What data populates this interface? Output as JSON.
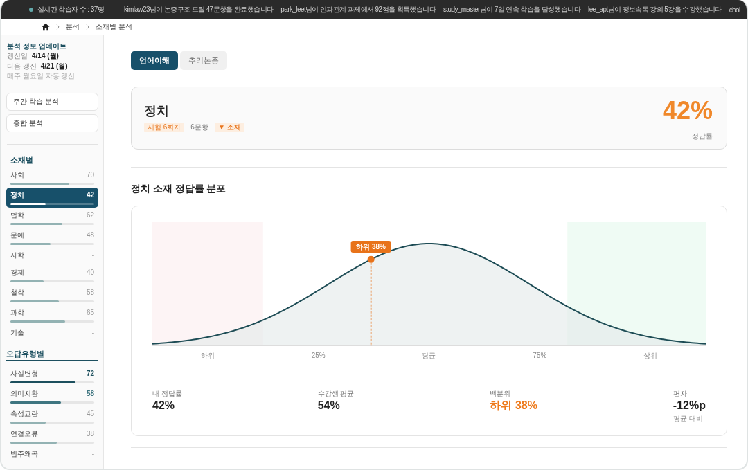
{
  "ticker": {
    "live_count": "실시간 학습자 수 : 37명",
    "messages": [
      "kimlaw23님이 논증구조 드릴 47문항을 완료했습니다",
      "park_leet님이 인과관계 과제에서 92점을 획득했습니다",
      "study_master님이 7일 연속 학습을 달성했습니다",
      "lee_apt님이 정보속독 강의 5강을 수강했습니다",
      "choi"
    ]
  },
  "breadcrumb": [
    "분석",
    "소재별 분석"
  ],
  "sidebar": {
    "update_info": {
      "title": "분석 정보 업데이트",
      "rows": [
        {
          "label": "갱신일",
          "value": "4/14 (월)"
        },
        {
          "label": "다음 갱신",
          "value": "4/21 (월)"
        }
      ],
      "note": "매주 월요일 자동 갱신"
    },
    "buttons": [
      "주간 학습 분석",
      "종합 분석"
    ],
    "sections": [
      {
        "title": "소재별",
        "kind": "topic",
        "items": [
          {
            "label": "사회",
            "value": "70",
            "level": 0.7,
            "selected": false
          },
          {
            "label": "정치",
            "value": "42",
            "level": 0.42,
            "selected": true
          },
          {
            "label": "법학",
            "value": "62",
            "level": 0.62,
            "selected": false
          },
          {
            "label": "문예",
            "value": "48",
            "level": 0.48,
            "selected": false
          },
          {
            "label": "사학",
            "value": "-",
            "selected": false
          },
          {
            "label": "경제",
            "value": "40",
            "level": 0.4,
            "selected": false
          },
          {
            "label": "철학",
            "value": "58",
            "level": 0.58,
            "selected": false
          },
          {
            "label": "과학",
            "value": "65",
            "level": 0.65,
            "selected": false
          },
          {
            "label": "기술",
            "value": "-",
            "selected": false
          }
        ]
      },
      {
        "title": "오답유형별",
        "kind": "error",
        "items": [
          {
            "label": "사실변형",
            "value": "72",
            "level": 0.78,
            "color": "#1c4f5d",
            "highlight": true,
            "selected": false
          },
          {
            "label": "의미치환",
            "value": "58",
            "level": 0.6,
            "color": "#3e7580",
            "highlight": true,
            "selected": false
          },
          {
            "label": "속성교란",
            "value": "45",
            "level": 0.42,
            "color": "#93b2b3",
            "highlight": false,
            "selected": false
          },
          {
            "label": "연결오류",
            "value": "38",
            "level": 0.55,
            "color": "#93b2b3",
            "highlight": false,
            "selected": false
          },
          {
            "label": "범주왜곡",
            "value": "-",
            "highlight": false,
            "selected": false
          }
        ]
      }
    ]
  },
  "tabs": [
    {
      "label": "언어이해",
      "selected": true
    },
    {
      "label": "추리논증",
      "selected": false
    }
  ],
  "summary": {
    "title": "정치",
    "tags": [
      {
        "text": "시험 6회차",
        "kind": "badge"
      },
      {
        "text": "6문항",
        "kind": "plain"
      },
      {
        "text": "▼ 소재",
        "kind": "flag"
      }
    ],
    "score": "42%",
    "score_label": "정답률"
  },
  "distribution": {
    "title": "정치 소재 정답률 분포",
    "axis_labels": [
      "하위",
      "25%",
      "평균",
      "75%",
      "상위"
    ],
    "marker": {
      "label": "하위 38%",
      "level": 0.395
    },
    "stats": [
      {
        "label": "내 정답률",
        "value": "42%",
        "highlight": false
      },
      {
        "label": "수강생 평균",
        "value": "54%",
        "highlight": false
      },
      {
        "label": "백분위",
        "value": "하위 38%",
        "highlight": true
      },
      {
        "label": "편차",
        "value": "-12%p",
        "note": "평균 대비",
        "highlight": false
      }
    ]
  }
}
